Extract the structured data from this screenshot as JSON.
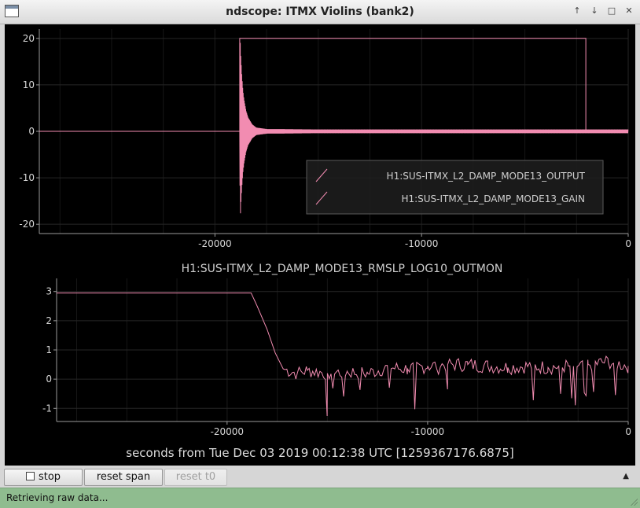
{
  "window": {
    "title": "ndscope: ITMX Violins (bank2)",
    "icon": "window-icon",
    "controls": [
      "up-arrow-icon",
      "down-arrow-icon",
      "maximize-icon",
      "close-icon"
    ]
  },
  "chart_data": [
    {
      "type": "line",
      "title": "",
      "xlim": [
        -28500,
        0
      ],
      "ylim": [
        -22,
        22
      ],
      "xticks": [
        -20000,
        -10000,
        0
      ],
      "yticks": [
        20,
        10,
        0,
        -10,
        -20
      ],
      "grid": true,
      "legend_placement": "lower-right",
      "series": [
        {
          "name": "H1:SUS-ITMX_L2_DAMP_MODE13_OUTPUT",
          "color": "#f28cb1",
          "x": [
            -28500,
            -18800,
            -18780,
            -18750,
            -18700,
            -18650,
            -18600,
            -18500,
            -18400,
            -18200,
            -18000,
            -17500,
            -15000,
            -10000,
            -5000,
            -2000,
            0
          ],
          "y_envelope": [
            0,
            0,
            19.5,
            16,
            12,
            9,
            7,
            4.5,
            3,
            1.5,
            0.8,
            0.5,
            0.4,
            0.4,
            0.4,
            0.4,
            0.4
          ]
        },
        {
          "name": "H1:SUS-ITMX_L2_DAMP_MODE13_GAIN",
          "color": "#f28cb1",
          "x": [
            -28500,
            -18800,
            -18800,
            -2050,
            -2050,
            0
          ],
          "y": [
            0,
            0,
            20,
            20,
            0,
            0
          ]
        }
      ]
    },
    {
      "type": "line",
      "title": "H1:SUS-ITMX_L2_DAMP_MODE13_RMSLP_LOG10_OUTMON",
      "xlim": [
        -28500,
        0
      ],
      "ylim": [
        -1.45,
        3.45
      ],
      "xticks": [
        -20000,
        -10000,
        0
      ],
      "yticks": [
        3,
        2,
        1,
        0,
        -1
      ],
      "grid": true,
      "series": [
        {
          "color": "#f28cb1",
          "x": [
            -28500,
            -18800,
            -18500,
            -18000,
            -17600,
            -17200,
            -16500,
            -16000,
            -15000,
            -14000,
            -13000,
            -12000,
            -11000,
            -10000,
            -9000,
            -8000,
            -7000,
            -6000,
            -5000,
            -4000,
            -3000,
            -2000,
            -1000,
            0
          ],
          "y": [
            2.95,
            2.95,
            2.5,
            1.7,
            0.9,
            0.35,
            0.2,
            0.3,
            0.2,
            0.25,
            0.2,
            0.4,
            0.35,
            0.45,
            0.5,
            0.5,
            0.45,
            0.4,
            0.45,
            0.4,
            0.45,
            0.5,
            0.6,
            0.45
          ]
        }
      ]
    }
  ],
  "plots": {
    "top": {
      "ytick_labels": [
        "20",
        "10",
        "0",
        "-10",
        "-20"
      ],
      "xtick_labels": [
        "-20000",
        "-10000",
        "0"
      ],
      "legend": [
        "H1:SUS-ITMX_L2_DAMP_MODE13_OUTPUT",
        "H1:SUS-ITMX_L2_DAMP_MODE13_GAIN"
      ]
    },
    "bottom": {
      "title": "H1:SUS-ITMX_L2_DAMP_MODE13_RMSLP_LOG10_OUTMON",
      "ytick_labels": [
        "3",
        "2",
        "1",
        "0",
        "-1"
      ],
      "xtick_labels": [
        "-20000",
        "-10000",
        "0"
      ]
    },
    "x_caption": "seconds from Tue Dec 03 2019 00:12:38 UTC [1259367176.6875]"
  },
  "toolbar": {
    "stop_label": "stop",
    "reset_span_label": "reset span",
    "reset_t0_label": "reset t0",
    "collapse_icon": "triangle-up-icon"
  },
  "status": {
    "text": "Retrieving raw data...",
    "color": "#8fbc8f"
  }
}
